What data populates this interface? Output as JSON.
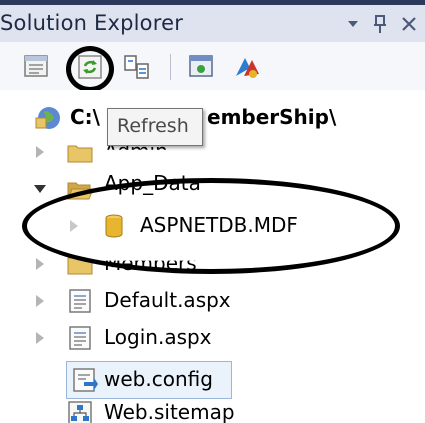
{
  "panel": {
    "title": "Solution Explorer"
  },
  "icons": {
    "dropdown": "dropdown-arrow-icon",
    "pin": "pin-icon",
    "close": "close-icon",
    "properties": "properties-icon",
    "refresh": "refresh-icon",
    "nest_related": "nest-related-files-icon",
    "view_designer": "view-designer-icon",
    "asp_config": "asp-net-configuration-icon"
  },
  "tooltip": {
    "text": "Refresh"
  },
  "tree": {
    "root": {
      "label_left": "C:\\",
      "label_right": "emberShip\\"
    },
    "items": [
      {
        "label": "Admin",
        "type": "folder",
        "state": "collapsed"
      },
      {
        "label": "App_Data",
        "type": "folder",
        "state": "expanded"
      },
      {
        "label": "ASPNETDB.MDF",
        "type": "database",
        "state": "collapsed"
      },
      {
        "label": "Members",
        "type": "folder",
        "state": "collapsed"
      },
      {
        "label": "Default.aspx",
        "type": "page",
        "state": "collapsed"
      },
      {
        "label": "Login.aspx",
        "type": "page",
        "state": "collapsed"
      },
      {
        "label": "web.config",
        "type": "config",
        "state": "selected"
      },
      {
        "label": "Web.sitemap",
        "type": "sitemap",
        "state": "none"
      }
    ]
  },
  "colors": {
    "header_bg": "#dfe3ef",
    "header_border": "#2b3a5c",
    "folder": "#e8c566",
    "database": "#e8b530",
    "selection": "#eaf2fc"
  }
}
